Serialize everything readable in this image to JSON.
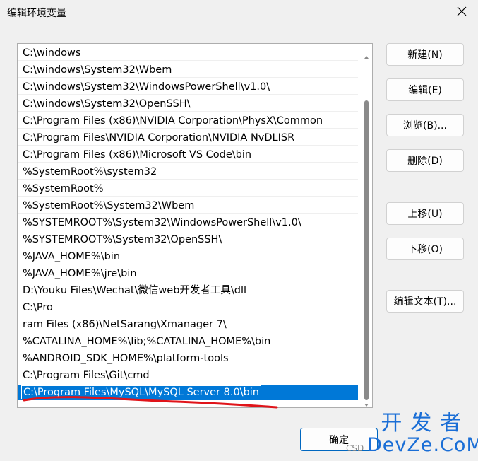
{
  "window": {
    "title": "编辑环境变量",
    "close_icon": "close-icon"
  },
  "path_list": {
    "items": [
      "C:\\windows",
      "C:\\windows\\System32\\Wbem",
      "C:\\windows\\System32\\WindowsPowerShell\\v1.0\\",
      "C:\\windows\\System32\\OpenSSH\\",
      "C:\\Program Files (x86)\\NVIDIA Corporation\\PhysX\\Common",
      "C:\\Program Files\\NVIDIA Corporation\\NVIDIA NvDLISR",
      "C:\\Program Files (x86)\\Microsoft VS Code\\bin",
      "%SystemRoot%\\system32",
      "%SystemRoot%",
      "%SystemRoot%\\System32\\Wbem",
      "%SYSTEMROOT%\\System32\\WindowsPowerShell\\v1.0\\",
      "%SYSTEMROOT%\\System32\\OpenSSH\\",
      "%JAVA_HOME%\\bin",
      "%JAVA_HOME%\\jre\\bin",
      "D:\\Youku Files\\Wechat\\微信web开发者工具\\dll",
      "C:\\Pro",
      "ram Files (x86)\\NetSarang\\Xmanager 7\\",
      "%CATALINA_HOME%\\lib;%CATALINA_HOME%\\bin",
      "%ANDROID_SDK_HOME%\\platform-tools",
      "C:\\Program Files\\Git\\cmd"
    ],
    "editing_value": "C:\\Program Files\\MySQL\\MySQL Server 8.0\\bin"
  },
  "buttons": {
    "new": "新建(N)",
    "edit": "编辑(E)",
    "browse": "浏览(B)...",
    "delete": "删除(D)",
    "move_up": "上移(U)",
    "move_down": "下移(O)",
    "edit_text": "编辑文本(T)...",
    "ok": "确定"
  },
  "colors": {
    "selection": "#0078d7",
    "annotation_underline": "#e0141a",
    "watermark": "#1a6ed6"
  },
  "watermark": {
    "line1": "开发者",
    "line2": "DevZe.CoM",
    "partial": "CSD"
  }
}
